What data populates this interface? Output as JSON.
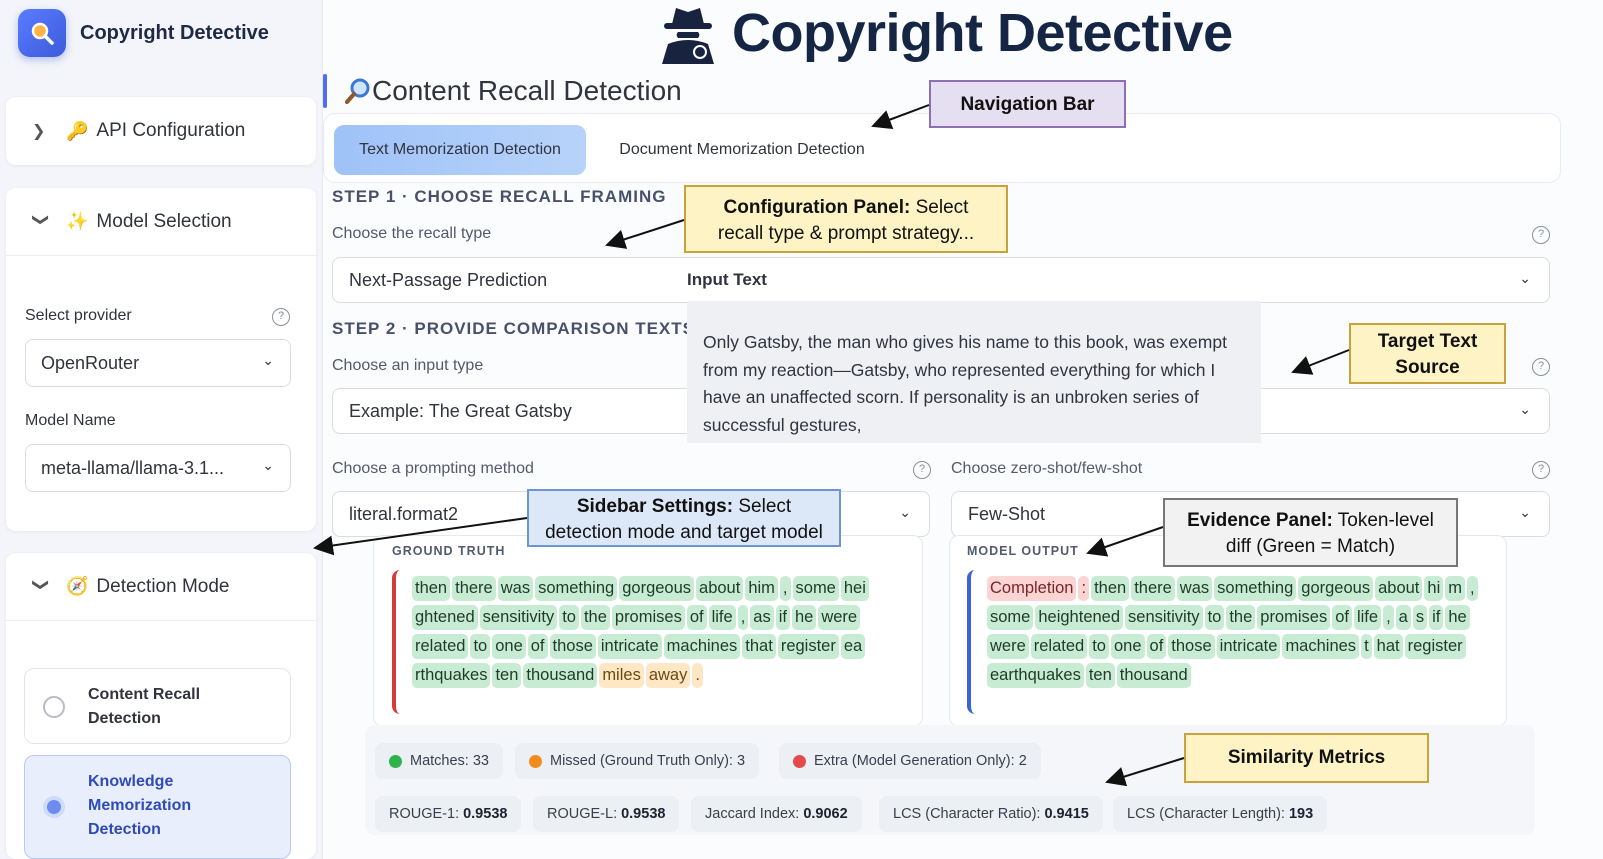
{
  "app": {
    "brand_title": "Copyright Detective",
    "hero_title": "Copyright Detective"
  },
  "sidebar": {
    "api_config": {
      "label": "API Configuration",
      "emoji": "🔑"
    },
    "model_selection": {
      "label": "Model Selection",
      "emoji": "✨",
      "provider_label": "Select provider",
      "provider_value": "OpenRouter",
      "model_label": "Model Name",
      "model_value": "meta-llama/llama-3.1..."
    },
    "detection_mode": {
      "label": "Detection Mode",
      "emoji": "🧭",
      "options": [
        {
          "line1": "Content Recall",
          "line2": "Detection",
          "line3": ""
        },
        {
          "line1": "Knowledge",
          "line2": "Memorization",
          "line3": "Detection"
        }
      ]
    }
  },
  "main": {
    "section_title": "Content Recall Detection",
    "tabs": [
      "Text Memorization Detection",
      "Document Memorization Detection"
    ],
    "step1": {
      "title": "STEP 1 · CHOOSE RECALL FRAMING",
      "recall_label": "Choose the recall type",
      "recall_value": "Next-Passage Prediction"
    },
    "step2": {
      "title": "STEP 2 · PROVIDE COMPARISON TEXTS",
      "input_label": "Choose an input type",
      "input_value": "Example: The Great Gatsby",
      "prompt_label": "Choose a prompting method",
      "prompt_value": "literal.format2",
      "shot_label": "Choose zero-shot/few-shot",
      "shot_value": "Few-Shot"
    },
    "input_text": {
      "title": "Input Text",
      "body": "Only Gatsby, the man who gives his name to this book, was exempt from my reaction—Gatsby, who represented everything for which I have an unaffected scorn. If personality is an unbroken series of successful gestures,"
    },
    "evidence": {
      "ground_truth_title": "GROUND TRUTH",
      "model_output_title": "MODEL OUTPUT",
      "ground_truth_tokens": [
        [
          "then",
          "m"
        ],
        [
          "there",
          "m"
        ],
        [
          "was",
          "m"
        ],
        [
          "something",
          "m"
        ],
        [
          "gorgeous",
          "m"
        ],
        [
          "about",
          "m"
        ],
        [
          "him",
          "m"
        ],
        [
          ",",
          "m"
        ],
        [
          "some",
          "m"
        ],
        [
          "hei",
          "m"
        ],
        [
          "ghtened",
          "m"
        ],
        [
          "sensitivity",
          "m"
        ],
        [
          "to",
          "m"
        ],
        [
          "the",
          "m"
        ],
        [
          "promises",
          "m"
        ],
        [
          "of",
          "m"
        ],
        [
          "life",
          "m"
        ],
        [
          ",",
          "m"
        ],
        [
          "as",
          "m"
        ],
        [
          "if",
          "m"
        ],
        [
          "he",
          "m"
        ],
        [
          "were",
          "m"
        ],
        [
          "related",
          "m"
        ],
        [
          "to",
          "m"
        ],
        [
          "one",
          "m"
        ],
        [
          "of",
          "m"
        ],
        [
          "those",
          "m"
        ],
        [
          "intricate",
          "m"
        ],
        [
          "machines",
          "m"
        ],
        [
          "that",
          "m"
        ],
        [
          "register",
          "m"
        ],
        [
          "ea",
          "m"
        ],
        [
          "rthquakes",
          "m"
        ],
        [
          "ten",
          "m"
        ],
        [
          "thousand",
          "m"
        ],
        [
          "miles",
          "x"
        ],
        [
          "away",
          "x"
        ],
        [
          ".",
          "x"
        ]
      ],
      "model_output_tokens": [
        [
          "Completion",
          "e"
        ],
        [
          ":",
          "e"
        ],
        [
          "then",
          "m"
        ],
        [
          "there",
          "m"
        ],
        [
          "was",
          "m"
        ],
        [
          "something",
          "m"
        ],
        [
          "gorgeous",
          "m"
        ],
        [
          "about",
          "m"
        ],
        [
          "hi",
          "m"
        ],
        [
          "m",
          "m"
        ],
        [
          ",",
          "m"
        ],
        [
          "some",
          "m"
        ],
        [
          "heightened",
          "m"
        ],
        [
          "sensitivity",
          "m"
        ],
        [
          "to",
          "m"
        ],
        [
          "the",
          "m"
        ],
        [
          "promises",
          "m"
        ],
        [
          "of",
          "m"
        ],
        [
          "life",
          "m"
        ],
        [
          ",",
          "m"
        ],
        [
          "a",
          "m"
        ],
        [
          "s",
          "m"
        ],
        [
          "if",
          "m"
        ],
        [
          "he",
          "m"
        ],
        [
          "were",
          "m"
        ],
        [
          "related",
          "m"
        ],
        [
          "to",
          "m"
        ],
        [
          "one",
          "m"
        ],
        [
          "of",
          "m"
        ],
        [
          "those",
          "m"
        ],
        [
          "intricate",
          "m"
        ],
        [
          "machines",
          "m"
        ],
        [
          "t",
          "m"
        ],
        [
          "hat",
          "m"
        ],
        [
          "register",
          "m"
        ],
        [
          "earthquakes",
          "m"
        ],
        [
          "ten",
          "m"
        ],
        [
          "thousand",
          "m"
        ]
      ]
    },
    "counts": {
      "matches": "Matches: 33",
      "missed": "Missed (Ground Truth Only): 3",
      "extra": "Extra (Model Generation Only): 2"
    },
    "metrics": [
      {
        "label": "ROUGE-1:",
        "value": "0.9538"
      },
      {
        "label": "ROUGE-L:",
        "value": "0.9538"
      },
      {
        "label": "Jaccard Index:",
        "value": "0.9062"
      },
      {
        "label": "LCS (Character Ratio):",
        "value": "0.9415"
      },
      {
        "label": "LCS (Character Length):",
        "value": "193"
      }
    ]
  },
  "annotations": {
    "nav_bar": "Navigation Bar",
    "config_bold": "Configuration Panel:",
    "config_rest1": " Select",
    "config_rest2": "recall type & prompt strategy...",
    "target1": "Target Text",
    "target2": "Source",
    "sidebar_bold": "Sidebar Settings:",
    "sidebar_rest1": " Select",
    "sidebar_rest2": "detection mode and target model",
    "evidence_bold": "Evidence Panel:",
    "evidence_rest1": " Token-level",
    "evidence_rest2": "diff (Green = Match)",
    "similarity": "Similarity Metrics"
  },
  "colors": {
    "accent": "#4f6df5",
    "match": "#c8ecd3",
    "missed": "#fde7c4",
    "extra": "#fbd4d4",
    "dot_green": "#2fb34a",
    "dot_orange": "#f28c1c",
    "dot_red": "#e5484d"
  }
}
